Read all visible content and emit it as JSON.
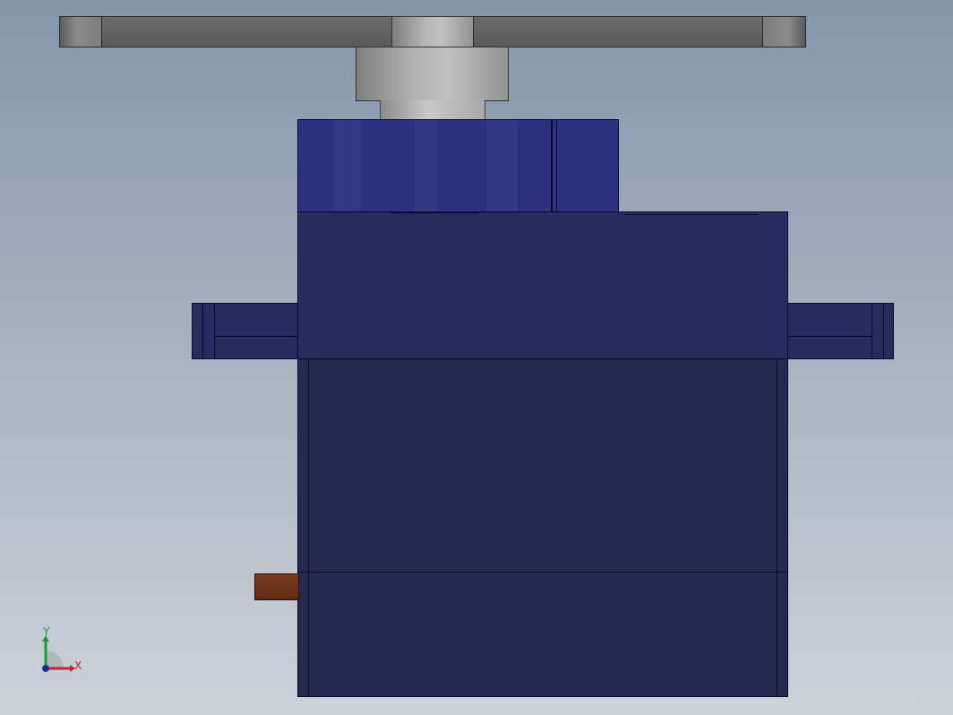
{
  "diagram": {
    "kind": "CAD front view of micro servo with horn",
    "colors": {
      "background_top": "#8496ab",
      "background_bottom": "#cdd2d9",
      "body": "#272b5f",
      "gear_cover": "#2b3180",
      "horn": "#6c6c6c",
      "cable": "#7a3a1c"
    }
  },
  "triad": {
    "x_label": "X",
    "y_label": "Y",
    "x_color": "#c0262b",
    "y_color": "#1f9a3a",
    "z_color": "#1a2f9a"
  }
}
